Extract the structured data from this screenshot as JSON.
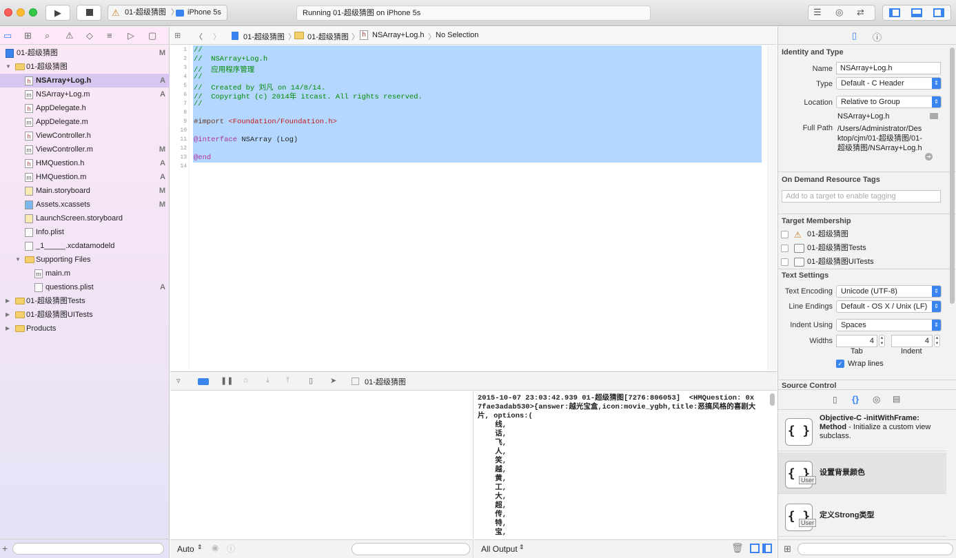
{
  "toolbar": {
    "scheme": "01-超级猜图",
    "device": "iPhone 5s",
    "status": "Running 01-超级猜图 on iPhone 5s"
  },
  "navigator": {
    "items": [
      {
        "label": "01-超级猜图",
        "status": "M"
      },
      {
        "label": "01-超级猜图",
        "status": ""
      },
      {
        "label": "NSArray+Log.h",
        "status": "A"
      },
      {
        "label": "NSArray+Log.m",
        "status": "A"
      },
      {
        "label": "AppDelegate.h",
        "status": ""
      },
      {
        "label": "AppDelegate.m",
        "status": ""
      },
      {
        "label": "ViewController.h",
        "status": ""
      },
      {
        "label": "ViewController.m",
        "status": "M"
      },
      {
        "label": "HMQuestion.h",
        "status": "A"
      },
      {
        "label": "HMQuestion.m",
        "status": "A"
      },
      {
        "label": "Main.storyboard",
        "status": "M"
      },
      {
        "label": "Assets.xcassets",
        "status": "M"
      },
      {
        "label": "LaunchScreen.storyboard",
        "status": ""
      },
      {
        "label": "Info.plist",
        "status": ""
      },
      {
        "label": "_1_____.xcdatamodeld",
        "status": ""
      },
      {
        "label": "Supporting Files",
        "status": ""
      },
      {
        "label": "main.m",
        "status": ""
      },
      {
        "label": "questions.plist",
        "status": "A"
      },
      {
        "label": "01-超级猜图Tests",
        "status": ""
      },
      {
        "label": "01-超级猜图UITests",
        "status": ""
      },
      {
        "label": "Products",
        "status": ""
      }
    ]
  },
  "jumpbar": {
    "project": "01-超级猜图",
    "group": "01-超级猜图",
    "file": "NSArray+Log.h",
    "selection": "No Selection"
  },
  "code": {
    "line_numbers": [
      "1",
      "2",
      "3",
      "4",
      "5",
      "6",
      "7",
      "8",
      "9",
      "10",
      "11",
      "12",
      "13",
      "14"
    ],
    "lines": [
      "//",
      "//  NSArray+Log.h",
      "//  应用程序管理",
      "//",
      "//  Created by 刘凡 on 14/8/14.",
      "//  Copyright (c) 2014年 itcast. All rights reserved.",
      "//",
      "",
      "#import ",
      "",
      "@interface",
      "",
      "@end",
      ""
    ],
    "import_path": "<Foundation/Foundation.h>",
    "interface_rest": " NSArray (Log)"
  },
  "debugbar": {
    "target": "01-超级猜图"
  },
  "console": {
    "text": "2015-10-07 23:03:42.939 01-超级猜图[7276:806053]  <HMQuestion: 0x7fae3adab530>{answer:越光宝盒,icon:movie_ygbh,title:恶搞风格的喜剧大片, options:(\n    线,\n    话,\n    飞,\n    人,\n    笑,\n    越,\n    黄,\n    工,\n    大,\n    超,\n    传,\n    特,\n    宝,"
  },
  "bottom": {
    "auto_label": "Auto",
    "output_label": "All Output"
  },
  "inspector": {
    "identity_header": "Identity and Type",
    "name_label": "Name",
    "name_value": "NSArray+Log.h",
    "type_label": "Type",
    "type_value": "Default - C Header",
    "location_label": "Location",
    "location_value": "Relative to Group",
    "location_file": "NSArray+Log.h",
    "fullpath_label": "Full Path",
    "fullpath_value": "/Users/Administrator/Desktop/cjm/01-超级猜图/01-超级猜图/NSArray+Log.h",
    "odr_header": "On Demand Resource Tags",
    "odr_placeholder": "Add to a target to enable tagging",
    "target_header": "Target Membership",
    "targets": [
      "01-超级猜图",
      "01-超级猜图Tests",
      "01-超级猜图UITests"
    ],
    "text_header": "Text Settings",
    "encoding_label": "Text Encoding",
    "encoding_value": "Unicode (UTF-8)",
    "endings_label": "Line Endings",
    "endings_value": "Default - OS X / Unix (LF)",
    "indent_label": "Indent Using",
    "indent_value": "Spaces",
    "widths_label": "Widths",
    "tab_value": "4",
    "indent_width_value": "4",
    "tab_label": "Tab",
    "indent_caption": "Indent",
    "wrap_label": "Wrap lines",
    "source_header": "Source Control"
  },
  "library": {
    "items": [
      {
        "title": "Objective-C -initWithFrame: Method",
        "desc": " - Initialize a custom view subclass."
      },
      {
        "title": "设置背景颜色",
        "desc": ""
      },
      {
        "title": "定义Strong类型",
        "desc": ""
      }
    ],
    "user_badge": "User"
  },
  "colors": {
    "selection": "#b4d7ff",
    "keyword": "#b0339b",
    "comment": "#008a00",
    "string": "#c41a16",
    "accent": "#3a84f0"
  }
}
